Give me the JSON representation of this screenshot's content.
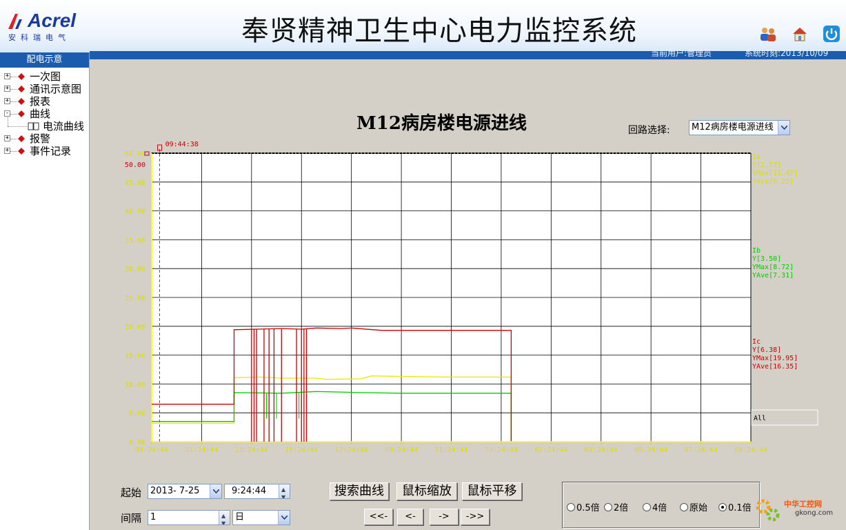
{
  "header": {
    "brand": "Acrel",
    "brand_sub": "安科瑞电气",
    "title": "奉贤精神卫生中心电力监控系统",
    "user_info": "当前用户:管理员",
    "time_info": "系统时刻:2013/10/09 ",
    "icons": [
      "users-icon",
      "home-icon",
      "power-icon"
    ]
  },
  "sidebar": {
    "title": "配电示意",
    "items": [
      {
        "label": "一次图",
        "expander": "+"
      },
      {
        "label": "通讯示意图",
        "expander": "+"
      },
      {
        "label": "报表",
        "expander": "+"
      },
      {
        "label": "曲线",
        "expander": "-"
      },
      {
        "label": "电流曲线",
        "expander": ""
      },
      {
        "label": "报警",
        "expander": "+"
      },
      {
        "label": "事件记录",
        "expander": "+"
      }
    ]
  },
  "main": {
    "chart_title": "M12病房楼电源进线",
    "loop_label": "回路选择:",
    "loop_value": "M12病房楼电源进线"
  },
  "chart_data": {
    "type": "line",
    "cursor_time": "09:44:38",
    "y_ticks": [
      "0.00",
      "5.00",
      "10.00",
      "15.00",
      "20.00",
      "25.00",
      "30.00",
      "35.00",
      "40.00",
      "45.00",
      "50.00"
    ],
    "y_top_label": "50.00",
    "x_ticks": [
      "09:24:44",
      "11:24:44",
      "13:24:44",
      "15:24:44",
      "17:24:44",
      "19:24:44",
      "21:24:44",
      "23:24:44",
      "01:24:44",
      "03:24:44",
      "05:24:44",
      "07:24:44",
      "09:24:44"
    ],
    "ylim": [
      0,
      50
    ],
    "grid": true,
    "series": [
      {
        "name": "Ia",
        "color": "#ffff00",
        "y": "Y[2.77]",
        "ymax": "YMax[11.47]",
        "yave": "YAve[9.22]",
        "points": [
          [
            0,
            3.2
          ],
          [
            1.65,
            3.2
          ],
          [
            1.65,
            11.1
          ],
          [
            2.2,
            11.2
          ],
          [
            2.6,
            11.0
          ],
          [
            3.3,
            11.0
          ],
          [
            3.5,
            10.8
          ],
          [
            4.2,
            10.9
          ],
          [
            4.4,
            11.4
          ],
          [
            5.0,
            11.3
          ],
          [
            6.0,
            11.2
          ],
          [
            7.2,
            11.2
          ],
          [
            7.2,
            0.1
          ]
        ]
      },
      {
        "name": "Ib",
        "color": "#00cc00",
        "y": "Y[3.50]",
        "ymax": "YMax[8.72]",
        "yave": "YAve[7.31]",
        "points": [
          [
            0,
            3.5
          ],
          [
            1.65,
            3.5
          ],
          [
            1.65,
            8.5
          ],
          [
            2.6,
            8.4
          ],
          [
            3.3,
            8.7
          ],
          [
            4.2,
            8.5
          ],
          [
            5.0,
            8.4
          ],
          [
            6.0,
            8.4
          ],
          [
            7.2,
            8.4
          ],
          [
            7.2,
            0.1
          ]
        ]
      },
      {
        "name": "Ic",
        "color": "#cc0000",
        "y": "Y[6.38]",
        "ymax": "YMax[19.95]",
        "yave": "YAve[16.35]",
        "points": [
          [
            0,
            6.5
          ],
          [
            1.65,
            6.5
          ],
          [
            1.65,
            19.4
          ],
          [
            2.6,
            19.6
          ],
          [
            3.0,
            19.5
          ],
          [
            3.3,
            19.7
          ],
          [
            3.8,
            19.6
          ],
          [
            4.0,
            19.7
          ],
          [
            4.6,
            19.3
          ],
          [
            5.0,
            19.3
          ],
          [
            6.0,
            19.3
          ],
          [
            7.2,
            19.3
          ],
          [
            7.2,
            0.1
          ]
        ]
      }
    ],
    "legend_all": "All"
  },
  "controls": {
    "start_label": "起始",
    "start_date": "2013- 7-25",
    "start_time": "9:24:44",
    "interval_label": "间隔",
    "interval_value": "1",
    "interval_unit": "日",
    "search_btn": "搜索曲线",
    "zoom_btn": "鼠标缩放",
    "pan_btn": "鼠标平移",
    "nav": [
      "<<-",
      "<-",
      "->",
      "->>"
    ],
    "radios": [
      {
        "label": "0.5倍",
        "selected": false
      },
      {
        "label": "2倍",
        "selected": false
      },
      {
        "label": "4倍",
        "selected": false
      },
      {
        "label": "原始",
        "selected": false
      },
      {
        "label": "0.1倍",
        "selected": true
      }
    ]
  },
  "watermark": {
    "line1": "中华工控网",
    "line2": "gkong.com"
  }
}
